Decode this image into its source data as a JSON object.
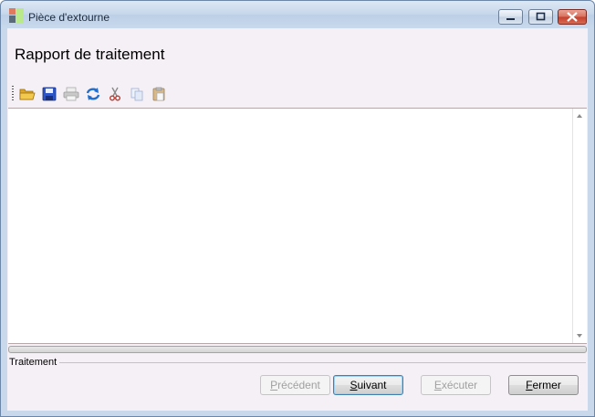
{
  "window": {
    "title": "Pièce d'extourne",
    "controls": [
      "minimize",
      "maximize",
      "close"
    ]
  },
  "page": {
    "heading": "Rapport de traitement"
  },
  "toolbar": {
    "items": [
      {
        "name": "open",
        "icon": "folder-open-icon",
        "enabled": true
      },
      {
        "name": "save",
        "icon": "floppy-disk-icon",
        "enabled": true
      },
      {
        "name": "print",
        "icon": "printer-icon",
        "enabled": false
      },
      {
        "name": "refresh",
        "icon": "refresh-icon",
        "enabled": true
      },
      {
        "name": "cut",
        "icon": "scissors-icon",
        "enabled": false
      },
      {
        "name": "copy",
        "icon": "copy-icon",
        "enabled": false
      },
      {
        "name": "paste",
        "icon": "clipboard-icon",
        "enabled": false
      }
    ]
  },
  "report": {
    "text": ""
  },
  "progress": {
    "value": 0
  },
  "group": {
    "label": "Traitement"
  },
  "buttons": {
    "previous": {
      "label": "Précédent",
      "enabled": false
    },
    "next": {
      "label": "Suivant",
      "enabled": true
    },
    "execute": {
      "label": "Exécuter",
      "enabled": false
    },
    "close": {
      "label": "Fermer",
      "enabled": true
    }
  }
}
